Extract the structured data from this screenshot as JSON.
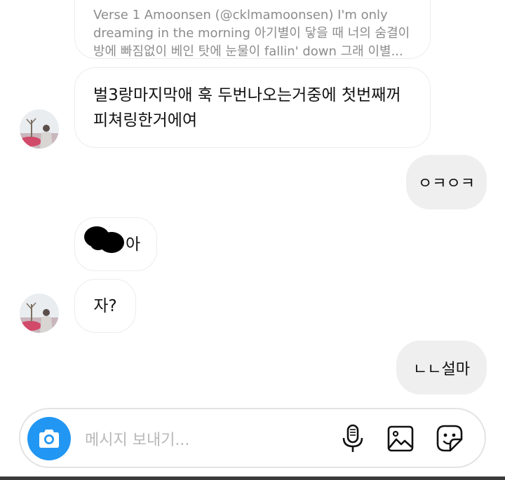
{
  "thread": {
    "quoted_message": {
      "lines": [
        "Verse 1 Amoonsen (@cklmamoonsen) I'm only",
        "dreaming in the morning 아기별이 닿을 때 너의 숨결이",
        "방에 빠짐없이 베인 탓에 눈물이 fallin' down 그래 이별..."
      ]
    },
    "messages": [
      {
        "side": "in",
        "lines": [
          "벌3랑마지막애 훅 두번나오는거중에 첫번째꺼",
          "피쳐링한거에여"
        ]
      },
      {
        "side": "out",
        "text": "ㅇㅋㅇㅋ"
      },
      {
        "side": "in",
        "text": "아",
        "censored_prefix": true
      },
      {
        "side": "in",
        "text": "자?"
      },
      {
        "side": "out",
        "text": "ㄴㄴ설마"
      }
    ]
  },
  "composer": {
    "placeholder": "메시지 보내기...",
    "icons": [
      "camera-icon",
      "microphone-icon",
      "gallery-icon",
      "sticker-icon"
    ],
    "camera_color": "#2196f3"
  }
}
